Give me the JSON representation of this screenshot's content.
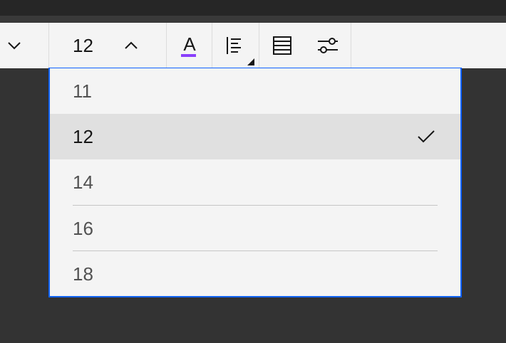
{
  "toolbar": {
    "font_size_value": "12",
    "text_color_underline": "#8a3ffc",
    "text_color_glyph": "A"
  },
  "dropdown": {
    "options": [
      {
        "label": "11",
        "selected": false
      },
      {
        "label": "12",
        "selected": true
      },
      {
        "label": "14",
        "selected": false
      },
      {
        "label": "16",
        "selected": false
      },
      {
        "label": "18",
        "selected": false
      }
    ],
    "border_color": "#0f62fe"
  },
  "icons": {
    "left_chevron": "chevron-down-icon",
    "size_chevron": "chevron-up-icon",
    "text_color": "text-color-icon",
    "align": "text-align-icon",
    "table": "table-icon",
    "settings": "settings-sliders-icon",
    "check": "checkmark-icon"
  }
}
